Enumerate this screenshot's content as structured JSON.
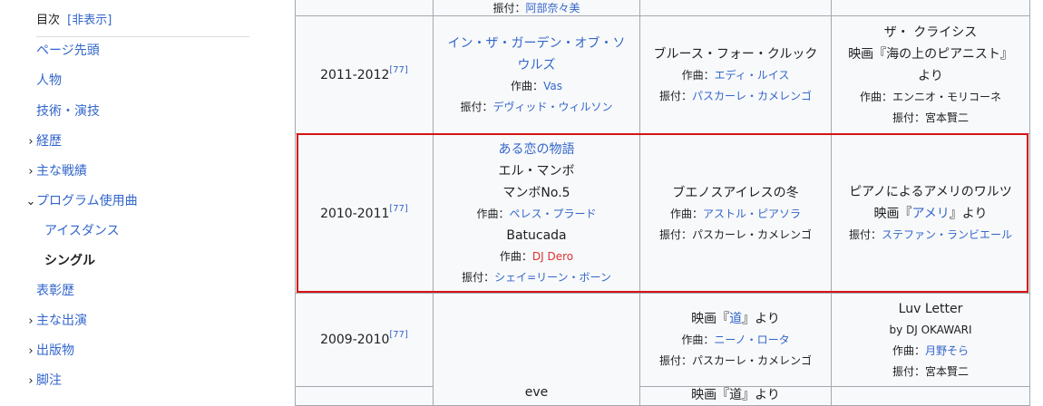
{
  "toc": {
    "title": "目次",
    "hide_label": "[非表示]",
    "items": [
      {
        "label": "ページ先頭",
        "chevron": ""
      },
      {
        "label": "人物",
        "chevron": ""
      },
      {
        "label": "技術・演技",
        "chevron": ""
      },
      {
        "label": "経歴",
        "chevron": ">"
      },
      {
        "label": "主な戦績",
        "chevron": ">"
      },
      {
        "label": "プログラム使用曲",
        "chevron": "v"
      },
      {
        "label": "アイスダンス",
        "chevron": ""
      },
      {
        "label": "シングル",
        "chevron": ""
      },
      {
        "label": "表彰歴",
        "chevron": ""
      },
      {
        "label": "主な出演",
        "chevron": ">"
      },
      {
        "label": "出版物",
        "chevron": ">"
      },
      {
        "label": "脚注",
        "chevron": ">"
      }
    ]
  },
  "table": {
    "top_partial": "振付：阿部奈々美",
    "ref": "[77]",
    "rows": [
      {
        "season": "2011-2012",
        "sp": {
          "title_line1": "イン・ザ・ガーデン・オブ・ソ",
          "title_line2": "ウルズ",
          "composer_prefix": "作曲：",
          "composer": "Vas",
          "choreo_prefix": "振付：",
          "choreo": "デヴィッド・ウィルソン"
        },
        "fs": {
          "title": "ブルース・フォー・クルック",
          "composer_prefix": "作曲：",
          "composer": "エディ・ルイス",
          "choreo_prefix": "振付：",
          "choreo": "パスカーレ・カメレンゴ"
        },
        "ex": {
          "title": "ザ・ クライシス",
          "source_line1": "映画『海の上のピアニスト』",
          "source_line2": "より",
          "composer": "作曲：エンニオ・モリコーネ",
          "choreo": "振付：宮本賢二"
        }
      },
      {
        "season": "2010-2011",
        "sp": {
          "title": "ある恋の物語",
          "line2": "エル・マンボ",
          "line3": "マンボNo.5",
          "composer1_prefix": "作曲：",
          "composer1": "ペレス・プラード",
          "line4": "Batucada",
          "composer2_prefix": "作曲：",
          "composer2": "DJ Dero",
          "choreo_prefix": "振付：",
          "choreo": "シェイ=リーン・ボーン"
        },
        "fs": {
          "title": "ブエノスアイレスの冬",
          "composer_prefix": "作曲：",
          "composer": "アストル・ピアソラ",
          "choreo": "振付：パスカーレ・カメレンゴ"
        },
        "ex": {
          "title": "ピアノによるアメリのワルツ",
          "source_prefix": "映画『",
          "source_link": "アメリ",
          "source_suffix": "』より",
          "choreo_prefix": "振付：",
          "choreo": "ステファン・ランビエール"
        }
      },
      {
        "season": "2009-2010",
        "sp": {
          "title_partial": "eve"
        },
        "fs": {
          "source_prefix": "映画『",
          "source_link": "道",
          "source_suffix": "』より",
          "composer_prefix": "作曲：",
          "composer": "ニーノ・ロータ",
          "choreo": "振付：パスカーレ・カメレンゴ",
          "next_partial": "映画『道』より"
        },
        "ex": {
          "title": "Luv Letter",
          "by": "by DJ OKAWARI",
          "composer_prefix": "作曲：",
          "composer": "月野そら",
          "choreo": "振付：宮本賢二"
        }
      }
    ]
  },
  "colors": {
    "link": "#3366cc",
    "red_link": "#dd3333",
    "highlight_border": "#d41515",
    "cell_bg": "#f8f9fa"
  }
}
